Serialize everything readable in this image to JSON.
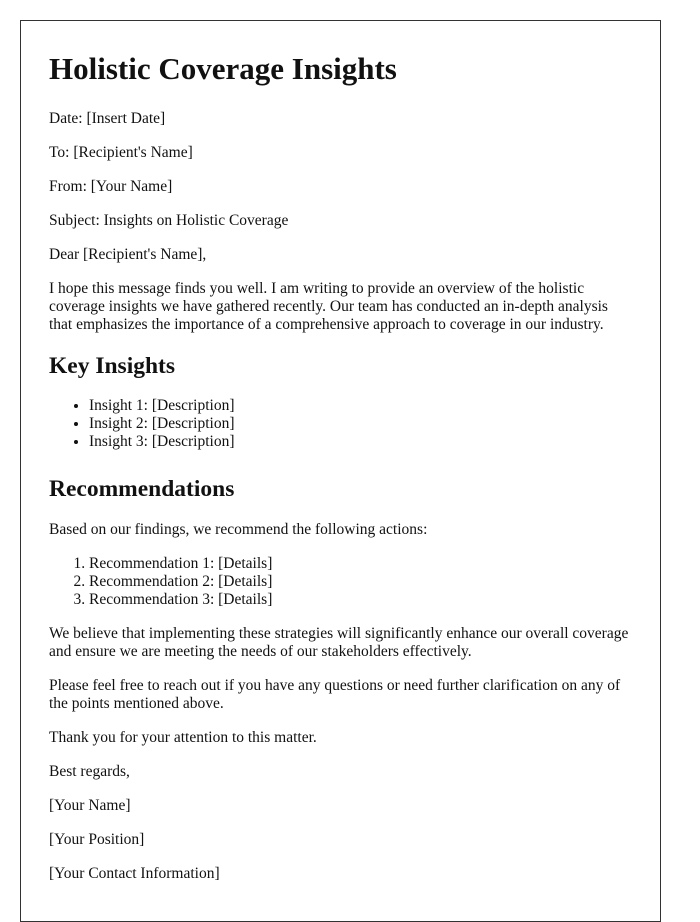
{
  "document": {
    "title": "Holistic Coverage Insights",
    "date_line": "Date: [Insert Date]",
    "to_line": "To: [Recipient's Name]",
    "from_line": "From: [Your Name]",
    "subject_line": "Subject: Insights on Holistic Coverage",
    "salutation": "Dear [Recipient's Name],",
    "intro_paragraph": "I hope this message finds you well. I am writing to provide an overview of the holistic coverage insights we have gathered recently. Our team has conducted an in-depth analysis that emphasizes the importance of a comprehensive approach to coverage in our industry.",
    "key_insights": {
      "heading": "Key Insights",
      "items": [
        "Insight 1: [Description]",
        "Insight 2: [Description]",
        "Insight 3: [Description]"
      ]
    },
    "recommendations": {
      "heading": "Recommendations",
      "intro": "Based on our findings, we recommend the following actions:",
      "items": [
        "Recommendation 1: [Details]",
        "Recommendation 2: [Details]",
        "Recommendation 3: [Details]"
      ]
    },
    "belief_paragraph": "We believe that implementing these strategies will significantly enhance our overall coverage and ensure we are meeting the needs of our stakeholders effectively.",
    "contact_paragraph": "Please feel free to reach out if you have any questions or need further clarification on any of the points mentioned above.",
    "thanks_line": "Thank you for your attention to this matter.",
    "closing": "Best regards,",
    "signature": {
      "name": "[Your Name]",
      "position": "[Your Position]",
      "contact": "[Your Contact Information]"
    }
  }
}
